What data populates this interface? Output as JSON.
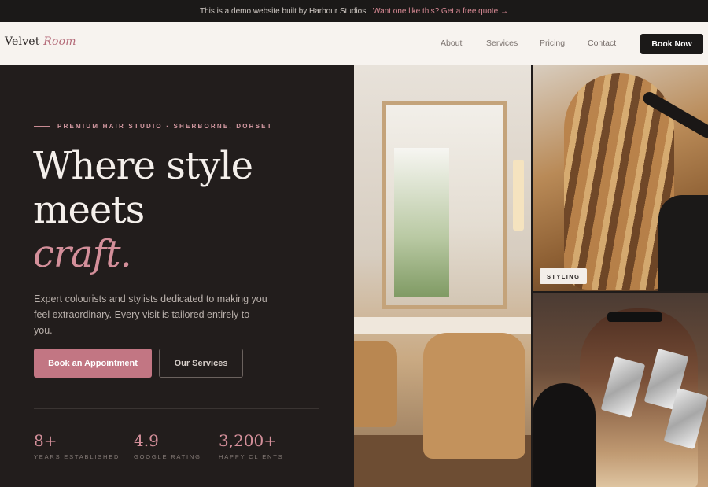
{
  "banner": {
    "text": "This is a demo website built by Harbour Studios.",
    "link": "Want one like this? Get a free quote →"
  },
  "nav": {
    "logo_main": "Velvet",
    "logo_accent": "Room",
    "links": [
      "About",
      "Services",
      "Pricing",
      "Contact"
    ],
    "cta": "Book Now"
  },
  "hero": {
    "eyebrow": "PREMIUM HAIR STUDIO · SHERBORNE, DORSET",
    "headline_line1": "Where style",
    "headline_line2": "meets",
    "headline_accent": "craft.",
    "lede": "Expert colourists and stylists dedicated to making you feel extraordinary. Every visit is tailored entirely to you.",
    "primary_cta": "Book an Appointment",
    "secondary_cta": "Our Services",
    "stats": [
      {
        "value": "8+",
        "label": "YEARS ESTABLISHED"
      },
      {
        "value": "4.9",
        "label": "GOOGLE RATING"
      },
      {
        "value": "3,200+",
        "label": "HAPPY CLIENTS"
      }
    ]
  },
  "gallery": {
    "styling_tag": "STYLING"
  },
  "colors": {
    "accent": "#c27683",
    "dark": "#1f1b1a",
    "cream": "#f7f3ef"
  }
}
